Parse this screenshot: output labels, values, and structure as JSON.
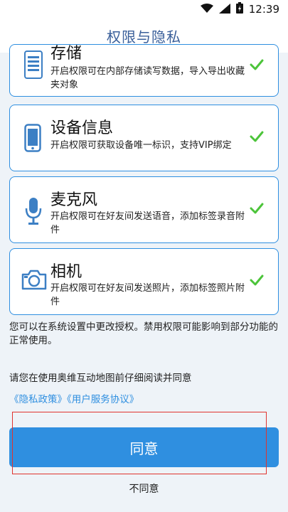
{
  "statusbar": {
    "time": "12:39",
    "icons": [
      "wifi-icon",
      "signal-icon",
      "battery-icon"
    ]
  },
  "header": {
    "title": "权限与隐私"
  },
  "permissions": [
    {
      "title": "存储",
      "desc": "开启权限可在内部存储读写数据，导入导出收藏夹对象",
      "icon": "storage-icon",
      "granted": true
    },
    {
      "title": "设备信息",
      "desc": "开启权限可获取设备唯一标识，支持VIP绑定",
      "icon": "phone-icon",
      "granted": true
    },
    {
      "title": "麦克风",
      "desc": "开启权限可在好友间发送语音，添加标签录音附件",
      "icon": "microphone-icon",
      "granted": true
    },
    {
      "title": "相机",
      "desc": "开启权限可在好友间发送照片，添加标签照片附件",
      "icon": "camera-icon",
      "granted": true
    }
  ],
  "notice": "您可以在系统设置中更改授权。禁用权限可能影响到部分功能的正常使用。",
  "read_prompt": "请您在使用奥维互动地图前仔细阅读并同意",
  "links": {
    "privacy": "《隐私政策》",
    "terms": "《用户服务协议》"
  },
  "buttons": {
    "agree": "同意",
    "disagree": "不同意"
  },
  "colors": {
    "accent": "#2f8fe0",
    "check": "#4cc43a",
    "title": "#3a5f9a",
    "highlight": "#e0332e"
  }
}
